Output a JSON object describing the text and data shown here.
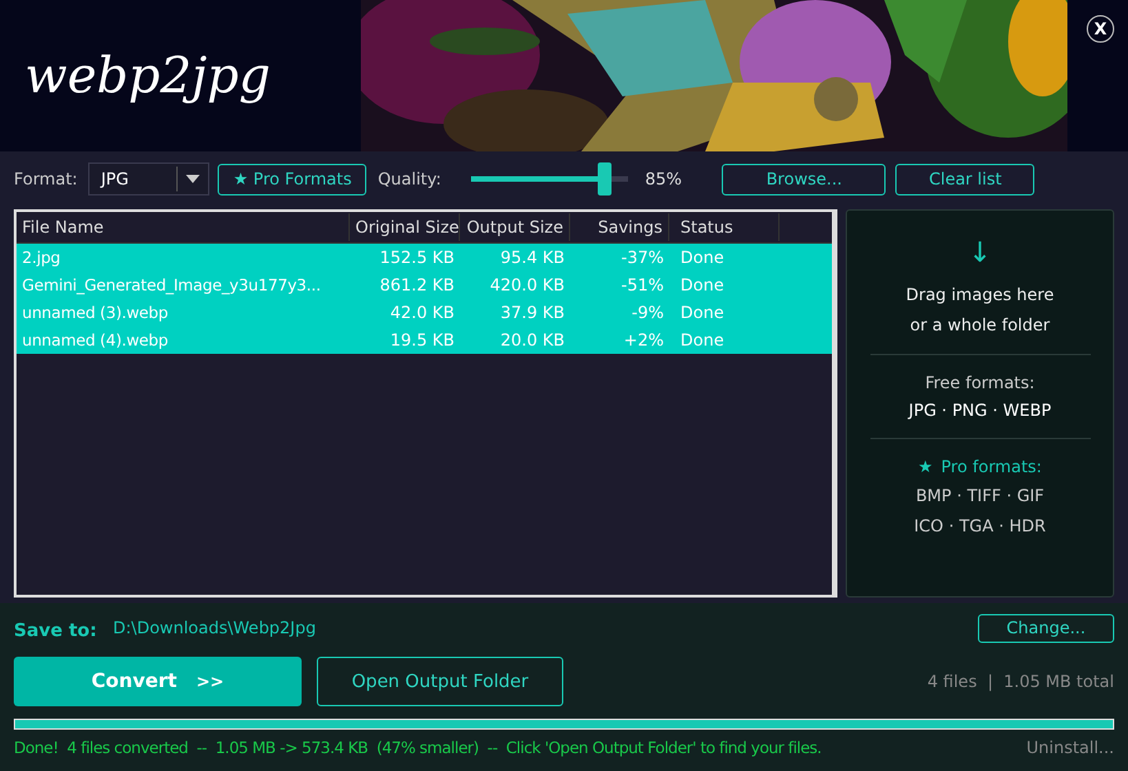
{
  "header": {
    "logo": "webp2jpg",
    "close": "X"
  },
  "toolbar": {
    "format_label": "Format:",
    "format_value": "JPG",
    "pro_button": "★ Pro Formats",
    "quality_label": "Quality:",
    "quality": {
      "level": 0.85,
      "reading": "85%"
    },
    "browse": "Browse...",
    "clear": "Clear list"
  },
  "table": {
    "columns": [
      "File Name",
      "Original Size",
      "Output Size",
      "Savings",
      "Status"
    ],
    "rows": [
      {
        "name": "2.jpg",
        "original": "152.5 KB",
        "output": "95.4 KB",
        "savings": "-37%",
        "status": "Done",
        "selected": true
      },
      {
        "name": "Gemini_Generated_Image_y3u177y3...",
        "original": "861.2 KB",
        "output": "420.0 KB",
        "savings": "-51%",
        "status": "Done",
        "selected": true
      },
      {
        "name": "unnamed (3).webp",
        "original": "42.0 KB",
        "output": "37.9 KB",
        "savings": "-9%",
        "status": "Done",
        "selected": true
      },
      {
        "name": "unnamed (4).webp",
        "original": "19.5 KB",
        "output": "20.0 KB",
        "savings": "+2%",
        "status": "Done",
        "selected": true
      }
    ]
  },
  "drop_panel": {
    "arrow": "↓",
    "hint": [
      "Drag images here",
      "or a whole folder"
    ],
    "free_title": "Free formats:",
    "free_list": "JPG · PNG · WEBP",
    "pro_star": "★",
    "pro_title": "Pro formats:",
    "pro_list": [
      "BMP · TIFF · GIF",
      "ICO · TGA · HDR"
    ]
  },
  "save": {
    "label": "Save to:",
    "path": "D:\\Downloads\\Webp2Jpg",
    "change": "Change..."
  },
  "actions": {
    "convert": "Convert",
    "convert_arrows": ">>",
    "open_folder": "Open Output Folder",
    "summary": "4 files  |  1.05 MB total"
  },
  "progress": {
    "level": 1
  },
  "status_bar": {
    "message": "Done!  4 files converted  --  1.05 MB -> 573.4 KB  (47% smaller)  --  Click 'Open Output Folder' to find your files.",
    "uninstall": "Uninstall..."
  }
}
